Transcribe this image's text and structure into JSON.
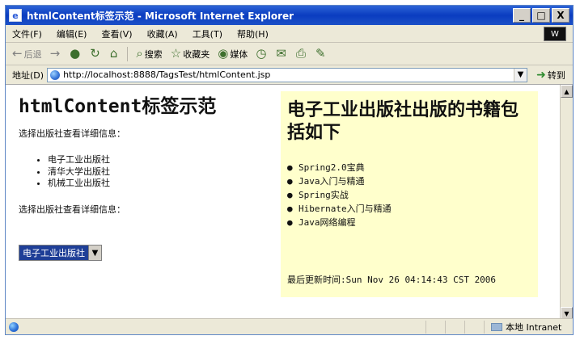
{
  "window": {
    "title": "htmlContent标签示范 - Microsoft Internet Explorer",
    "icon_letter": "e",
    "controls": {
      "minimize": "_",
      "maximize": "□",
      "close": "X"
    }
  },
  "menu": {
    "items": [
      "文件(F)",
      "编辑(E)",
      "查看(V)",
      "收藏(A)",
      "工具(T)",
      "帮助(H)"
    ],
    "logo_text": "W"
  },
  "toolbar": {
    "back_label": "后退",
    "search_label": "搜索",
    "favorites_label": "收藏夹",
    "media_label": "媒体",
    "icons": {
      "back": "back-arrow-icon",
      "forward": "forward-arrow-icon",
      "stop": "stop-icon",
      "refresh": "refresh-icon",
      "home": "home-icon",
      "search": "search-icon",
      "favorites": "favorites-icon",
      "media": "media-icon",
      "history": "history-icon",
      "mail": "mail-icon",
      "print": "print-icon",
      "edit": "edit-icon"
    }
  },
  "address_bar": {
    "label": "地址(D)",
    "url": "http://localhost:8888/TagsTest/htmlContent.jsp",
    "go_label": "转到"
  },
  "page": {
    "heading": "htmlContent标签示范",
    "instruction_top": "选择出版社查看详细信息：",
    "publishers": [
      "电子工业出版社",
      "清华大学出版社",
      "机械工业出版社"
    ],
    "instruction_bottom": "选择出版社查看详细信息：",
    "selected_publisher": "电子工业出版社",
    "right_panel": {
      "title": "电子工业出版社出版的书籍包括如下",
      "books": [
        "Spring2.0宝典",
        "Java入门与精通",
        "Spring实战",
        "Hibernate入门与精通",
        "Java网络编程"
      ],
      "last_updated": "最后更新时间:Sun Nov 26 04:14:43 CST 2006"
    }
  },
  "status": {
    "zone": "本地 Intranet"
  },
  "colors": {
    "titlebar": "#0a3cc0",
    "panel_background": "#ffffcc",
    "selected_background": "#1f3f97"
  }
}
